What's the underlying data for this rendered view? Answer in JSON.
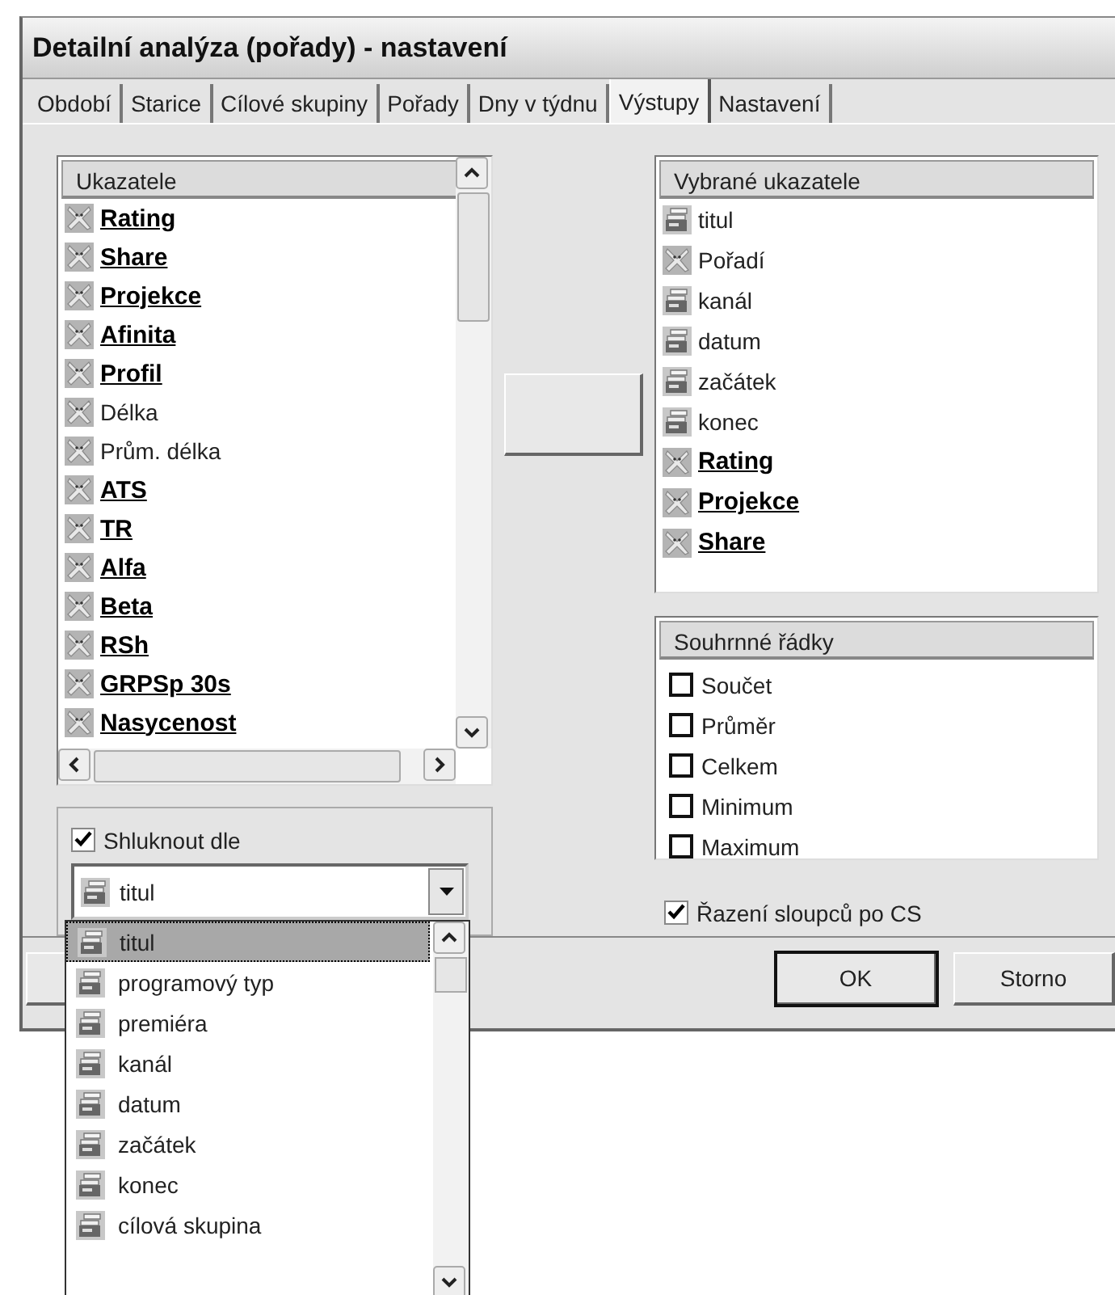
{
  "window": {
    "title": "Detailní analýza (pořady) - nastavení"
  },
  "tabs": [
    {
      "label": "Období",
      "selected": false
    },
    {
      "label": "Starice",
      "selected": false
    },
    {
      "label": "Cílové skupiny",
      "selected": false
    },
    {
      "label": "Pořady",
      "selected": false
    },
    {
      "label": "Dny v týdnu",
      "selected": false
    },
    {
      "label": "Výstupy",
      "selected": true
    },
    {
      "label": "Nastavení",
      "selected": false
    }
  ],
  "indicators": {
    "header": "Ukazatele",
    "items": [
      {
        "kind": "measure",
        "label": "Rating",
        "primary": true
      },
      {
        "kind": "measure",
        "label": "Share",
        "primary": true
      },
      {
        "kind": "measure",
        "label": "Projekce",
        "primary": true
      },
      {
        "kind": "measure",
        "label": "Afinita",
        "primary": true
      },
      {
        "kind": "measure",
        "label": "Profil",
        "primary": true
      },
      {
        "kind": "measure",
        "label": "Délka",
        "primary": false
      },
      {
        "kind": "measure",
        "label": "Prům. délka",
        "primary": false
      },
      {
        "kind": "measure",
        "label": "ATS",
        "primary": true
      },
      {
        "kind": "measure",
        "label": "TR",
        "primary": true
      },
      {
        "kind": "measure",
        "label": "Alfa",
        "primary": true
      },
      {
        "kind": "measure",
        "label": "Beta",
        "primary": true
      },
      {
        "kind": "measure",
        "label": "RSh",
        "primary": true
      },
      {
        "kind": "measure",
        "label": "GRPSp 30s",
        "primary": true
      },
      {
        "kind": "measure",
        "label": "Nasycenost",
        "primary": true
      }
    ]
  },
  "selected_indicators": {
    "header": "Vybrané ukazatele",
    "items": [
      {
        "kind": "dimension",
        "label": "titul",
        "primary": false
      },
      {
        "kind": "measure",
        "label": "Pořadí",
        "primary": false
      },
      {
        "kind": "dimension",
        "label": "kanál",
        "primary": false
      },
      {
        "kind": "dimension",
        "label": "datum",
        "primary": false
      },
      {
        "kind": "dimension",
        "label": "začátek",
        "primary": false
      },
      {
        "kind": "dimension",
        "label": "konec",
        "primary": false
      },
      {
        "kind": "measure",
        "label": "Rating",
        "primary": true
      },
      {
        "kind": "measure",
        "label": "Projekce",
        "primary": true
      },
      {
        "kind": "measure",
        "label": "Share",
        "primary": true
      }
    ]
  },
  "summary_rows": {
    "header": "Souhrnné řádky",
    "items": [
      {
        "label": "Součet",
        "checked": false
      },
      {
        "label": "Průměr",
        "checked": false
      },
      {
        "label": "Celkem",
        "checked": false
      },
      {
        "label": "Minimum",
        "checked": false
      },
      {
        "label": "Maximum",
        "checked": false
      }
    ]
  },
  "group_by": {
    "label": "Shluknout dle",
    "checked": true,
    "value": {
      "kind": "dimension",
      "label": "titul"
    }
  },
  "group_by_options": [
    {
      "kind": "dimension",
      "label": "titul",
      "selected": true
    },
    {
      "kind": "dimension",
      "label": "programový typ",
      "selected": false
    },
    {
      "kind": "dimension",
      "label": "premiéra",
      "selected": false
    },
    {
      "kind": "dimension",
      "label": "kanál",
      "selected": false
    },
    {
      "kind": "dimension",
      "label": "datum",
      "selected": false
    },
    {
      "kind": "dimension",
      "label": "začátek",
      "selected": false
    },
    {
      "kind": "dimension",
      "label": "konec",
      "selected": false
    },
    {
      "kind": "dimension",
      "label": "cílová skupina",
      "selected": false
    }
  ],
  "sort_columns": {
    "label": "Řazení sloupců po CS",
    "checked": true
  },
  "buttons": [
    {
      "label": "OK",
      "default": true
    },
    {
      "label": "Storno",
      "default": false
    }
  ]
}
